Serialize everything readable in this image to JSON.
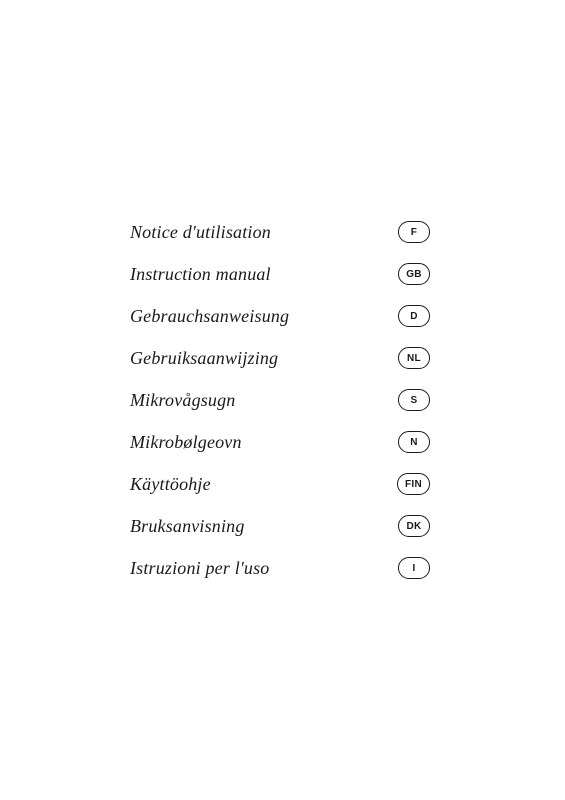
{
  "manual_items": [
    {
      "label": "Notice d'utilisation",
      "badge": "F"
    },
    {
      "label": "Instruction manual",
      "badge": "GB"
    },
    {
      "label": "Gebrauchsanweisung",
      "badge": "D"
    },
    {
      "label": "Gebruiksaanwijzing",
      "badge": "NL"
    },
    {
      "label": "Mikrovågsugn",
      "badge": "S"
    },
    {
      "label": "Mikrobølgeovn",
      "badge": "N"
    },
    {
      "label": "Käyttöohje",
      "badge": "FIN"
    },
    {
      "label": "Bruksanvisning",
      "badge": "DK"
    },
    {
      "label": "Istruzioni per l'uso",
      "badge": "I"
    }
  ]
}
